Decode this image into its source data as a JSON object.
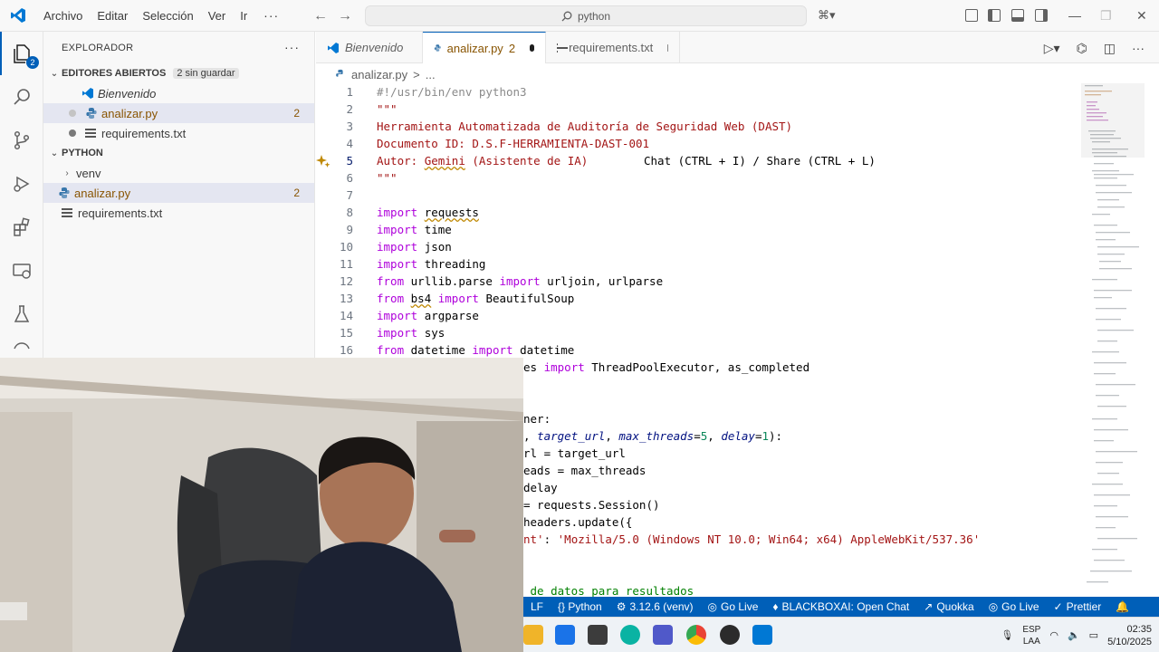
{
  "titlebar": {
    "menu": [
      "Archivo",
      "Editar",
      "Selección",
      "Ver",
      "Ir"
    ],
    "more": "···",
    "search_text": "python"
  },
  "activity": {
    "explorer_badge": "2"
  },
  "sidebar": {
    "title": "EXPLORADOR",
    "open_editors": {
      "label": "EDITORES ABIERTOS",
      "badge": "2 sin guardar",
      "items": [
        {
          "name": "Bienvenido",
          "count": ""
        },
        {
          "name": "analizar.py",
          "count": "2"
        },
        {
          "name": "requirements.txt",
          "count": ""
        }
      ]
    },
    "folder": {
      "label": "PYTHON",
      "items": [
        {
          "name": "venv"
        },
        {
          "name": "analizar.py",
          "count": "2"
        },
        {
          "name": "requirements.txt"
        }
      ]
    }
  },
  "tabs": [
    {
      "label": "Bienvenido"
    },
    {
      "label": "analizar.py",
      "count": "2"
    },
    {
      "label": "requirements.txt"
    }
  ],
  "breadcrumb": {
    "file": "analizar.py",
    "sep": ">",
    "rest": "..."
  },
  "code": {
    "hint": "Chat (CTRL + I) / Share (CTRL + L)",
    "line_numbers": [
      "1",
      "2",
      "3",
      "4",
      "5",
      "6",
      "7",
      "8",
      "9",
      "10",
      "11",
      "12",
      "13",
      "14",
      "15",
      "16"
    ],
    "lines": {
      "l1": "#!/usr/bin/env python3",
      "l2": "\"\"\"",
      "l3": "Herramienta Automatizada de Auditoría de Seguridad Web (DAST)",
      "l4": "Documento ID: D.S.F-HERRAMIENTA-DAST-001",
      "l5a": "Autor: ",
      "l5b": "Gemini",
      "l5c": " (Asistente de IA)",
      "l6": "\"\"\"",
      "kw_import": "import",
      "kw_from": "from",
      "l8": "requests",
      "l9": "time",
      "l10": "json",
      "l11": "threading",
      "l12a": "urllib.parse",
      "l12b": "urljoin, urlparse",
      "l13a": "bs4",
      "l13b": "BeautifulSoup",
      "l14": "argparse",
      "l15": "sys",
      "l16a": "datetime",
      "l16b": "datetime",
      "l17a": "es",
      "l17b": "ThreadPoolExecutor, as_completed",
      "l20": "ner:",
      "l21a": ", ",
      "l21b": "target_url",
      "l21c": ", ",
      "l21d": "max_threads",
      "l21e": "=",
      "l21f": "5",
      "l21g": ", ",
      "l21h": "delay",
      "l21i": "=",
      "l21j": "1",
      "l21k": "):",
      "l22": "rl = target_url",
      "l23": "eads = max_threads",
      "l24": "delay",
      "l25": "= requests.Session()",
      "l26": "headers.update({",
      "l27a": "nt'",
      "l27b": ": ",
      "l27c": "'Mozilla/5.0 (Windows NT 10.0; Win64; x64) AppleWebKit/537.36'",
      "l30": " de datos para resultados"
    }
  },
  "statusbar": {
    "items": [
      "LF",
      "{} Python",
      "3.12.6 (venv)",
      "Go Live",
      "BLACKBOXAI: Open Chat",
      "Quokka",
      "Go Live",
      "Prettier"
    ]
  },
  "taskbar": {
    "lang_1": "ESP",
    "lang_2": "LAA",
    "time": "02:35",
    "date": "5/10/2025"
  },
  "colors": {
    "accent": "#005fb8",
    "keyword": "#af00db",
    "string": "#a31515",
    "warning": "#895503"
  }
}
